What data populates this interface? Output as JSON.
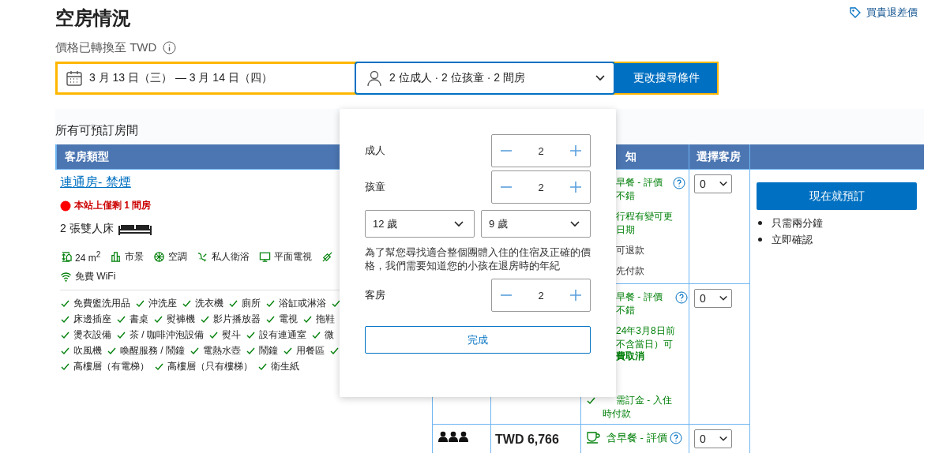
{
  "header": {
    "title": "空房情況",
    "price_note": "價格已轉換至 TWD",
    "price_match": "買貴退差價"
  },
  "search": {
    "dates": "3 月 13 日（三） — 3 月 14 日（四）",
    "guests": "2 位成人 · 2 位孩童 · 2 間房",
    "button": "更改搜尋條件"
  },
  "section_title": "所有可預訂房間",
  "table": {
    "columns": [
      "客房類型",
      "知",
      "選擇客房"
    ],
    "room": {
      "name": "連通房- 禁煙",
      "scarcity": "本站上僅剩 1 間房",
      "beds": "2 張雙人床",
      "facilities": [
        {
          "kind": "size",
          "text": "24 m$^{2}$"
        },
        {
          "kind": "city",
          "text": "市景"
        },
        {
          "kind": "ac",
          "text": "空調"
        },
        {
          "kind": "bath",
          "text": "私人衛浴"
        },
        {
          "kind": "tv",
          "text": "平面電視"
        },
        {
          "kind": "soundproof"
        },
        {
          "kind": "wifi",
          "text": "免費 WiFi"
        }
      ],
      "amenity_lines": [
        {
          "items": [
            "免費盥洗用品",
            "沖洗座",
            "洗衣機",
            "廁所",
            "浴缸或淋浴"
          ],
          "cut": true
        },
        {
          "items": [
            "床邊插座",
            "書桌",
            "熨褲機",
            "影片播放器",
            "電視",
            "拖鞋"
          ],
          "cut": false
        },
        {
          "items": [
            "燙衣設備",
            "茶 / 咖啡沖泡設備",
            "熨斗",
            "設有連通室",
            "微"
          ],
          "cut": false
        },
        {
          "items": [
            "吹風機",
            "喚醒服務 / 鬧鐘",
            "電熱水壺",
            "鬧鐘",
            "用餐區"
          ],
          "cut": true
        },
        {
          "items": [
            "高樓層（有電梯）",
            "高樓層（只有樓梯）",
            "衛生紙"
          ],
          "cut": false
        }
      ]
    },
    "offers": [
      {
        "kind": "covered",
        "select": "0",
        "help": true,
        "conditions": [
          {
            "kind": "perk",
            "lines": [
              "早餐 - 評價",
              "不錯"
            ],
            "bold": false
          },
          {
            "kind": "perk",
            "lines": [
              "行程有變可更",
              "日期"
            ],
            "bold": false
          },
          {
            "kind": "note",
            "lines": [
              "可退款"
            ],
            "bold": false
          },
          {
            "kind": "note",
            "lines": [
              "先付款"
            ],
            "bold": false
          }
        ]
      },
      {
        "kind": "covered",
        "select": "0",
        "help": true,
        "conditions": [
          {
            "kind": "perk",
            "lines": [
              "早餐 - 評價",
              "不錯"
            ],
            "bold": false
          },
          {
            "kind": "perk",
            "lines": [
              "24年3月8日前",
              "不含當日）可"
            ],
            "bold": false
          },
          {
            "kind": "perk",
            "lines": [
              "費取消"
            ],
            "bold": true
          },
          {
            "kind": "check",
            "lines": [
              "需訂金 - 入住",
              "時付款"
            ],
            "bold": false
          }
        ]
      },
      {
        "kind": "full",
        "price": "TWD 6,766",
        "select": "0",
        "help": true,
        "conditions": [
          {
            "kind": "cup",
            "lines": [
              "含早餐 - 評價"
            ],
            "bold": false
          }
        ]
      }
    ],
    "book": {
      "button": "現在就預訂",
      "bullets": [
        "只需兩分鐘",
        "立即確認"
      ]
    }
  },
  "occupancy_popup": {
    "counters": [
      {
        "label": "成人",
        "value": "2"
      },
      {
        "label": "孩童",
        "value": "2"
      }
    ],
    "child_ages": [
      "12 歲",
      "9 歲"
    ],
    "note": "為了幫您尋找適合整個團體入住的住宿及正確的價格，我們需要知道您的小孩在退房時的年紀",
    "rooms": {
      "label": "客房",
      "value": "2"
    },
    "done": "完成"
  }
}
